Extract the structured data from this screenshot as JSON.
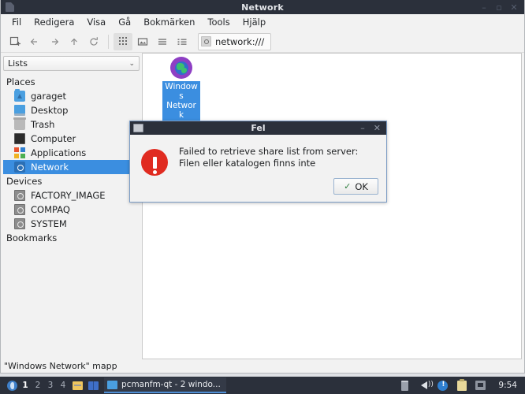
{
  "window": {
    "title": "Network",
    "icon": "document-icon",
    "buttons": {
      "minimize": "–",
      "maximize": "▫",
      "close": "✕"
    }
  },
  "menubar": {
    "items": [
      {
        "label": "Fil"
      },
      {
        "label": "Redigera"
      },
      {
        "label": "Visa"
      },
      {
        "label": "Gå"
      },
      {
        "label": "Bokmärken"
      },
      {
        "label": "Tools"
      },
      {
        "label": "Hjälp"
      }
    ]
  },
  "toolbar": {
    "new_tab_icon": "new-tab-icon",
    "back_icon": "arrow-left-icon",
    "forward_icon": "arrow-right-icon",
    "up_icon": "arrow-up-icon",
    "reload_icon": "reload-icon",
    "view_icon_mode": "grid-view-icon",
    "view_thumbnail_mode": "thumbnail-view-icon",
    "view_compact_mode": "compact-view-icon",
    "view_detail_mode": "detail-view-icon",
    "path": "network:///"
  },
  "sidebar": {
    "combo": {
      "value": "Lists",
      "chevron": "⌄"
    },
    "groups": [
      {
        "label": "Places",
        "items": [
          {
            "label": "garaget",
            "icon": "folder-icon",
            "selected": false
          },
          {
            "label": "Desktop",
            "icon": "desktop-icon",
            "selected": false
          },
          {
            "label": "Trash",
            "icon": "trash-icon",
            "selected": false
          },
          {
            "label": "Computer",
            "icon": "computer-icon",
            "selected": false
          },
          {
            "label": "Applications",
            "icon": "applications-icon",
            "selected": false
          },
          {
            "label": "Network",
            "icon": "network-icon",
            "selected": true
          }
        ]
      },
      {
        "label": "Devices",
        "items": [
          {
            "label": "FACTORY_IMAGE",
            "icon": "drive-icon",
            "selected": false
          },
          {
            "label": "COMPAQ",
            "icon": "drive-icon",
            "selected": false
          },
          {
            "label": "SYSTEM",
            "icon": "drive-icon",
            "selected": false
          }
        ]
      },
      {
        "label": "Bookmarks",
        "items": []
      }
    ]
  },
  "fileview": {
    "items": [
      {
        "label": "Windows Network",
        "icon": "network-globe-icon",
        "selected": true
      }
    ]
  },
  "statusbar": {
    "text": "\"Windows Network\" mapp"
  },
  "dialog": {
    "title": "Fel",
    "icon": "window-icon",
    "minimize": "–",
    "close": "✕",
    "error_icon": "error-exclamation-icon",
    "message": "Failed to retrieve share list from server: Filen eller katalogen finns inte",
    "ok_label": "OK",
    "ok_check": "✓"
  },
  "taskbar": {
    "start_icon": "start-menu-icon",
    "desktops": [
      "1",
      "2",
      "3",
      "4"
    ],
    "current_desktop": "1",
    "quicklaunch": [
      {
        "icon": "file-manager-icon"
      },
      {
        "icon": "book-reader-icon"
      }
    ],
    "tasks": [
      {
        "label": "pcmanfm-qt - 2 windo...",
        "icon": "folder-window-icon",
        "active": true
      }
    ],
    "tray": [
      {
        "icon": "battery-icon"
      },
      {
        "icon": "volume-icon"
      },
      {
        "icon": "update-icon"
      },
      {
        "icon": "clipboard-icon"
      },
      {
        "icon": "network-tray-icon"
      }
    ],
    "clock": "9:54"
  },
  "colors": {
    "titlebar": "#2b303b",
    "selection": "#3b8ee0",
    "error_red": "#e02b20",
    "accent_purple": "#8e3fc4"
  }
}
